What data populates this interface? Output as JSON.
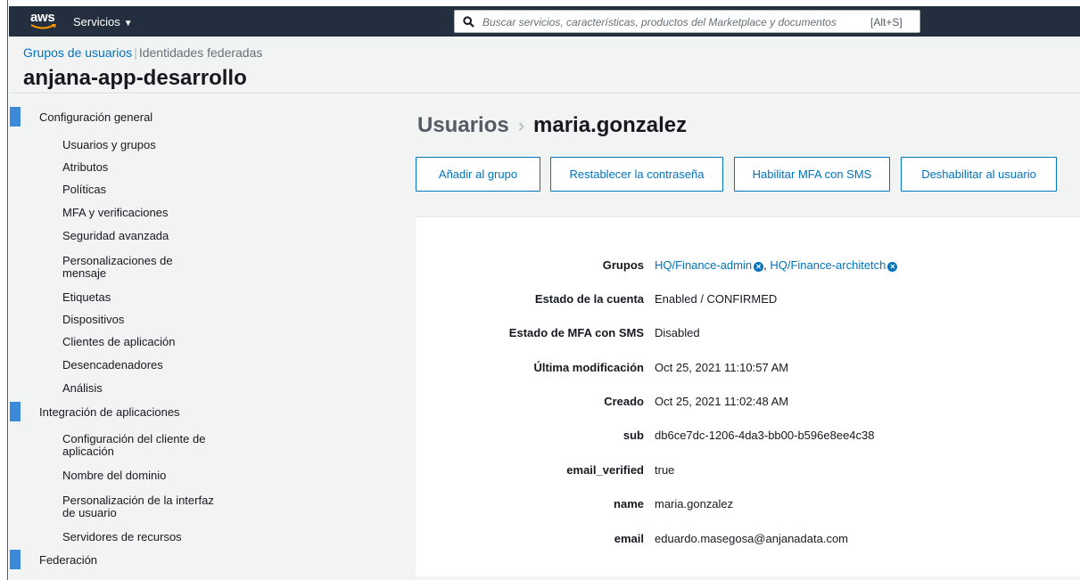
{
  "topnav": {
    "logo_text": "aws",
    "services_label": "Servicios",
    "search_placeholder": "Buscar servicios, características, productos del Marketplace y documentos",
    "search_shortcut": "[Alt+S]"
  },
  "header": {
    "tab_active": "Grupos de usuarios",
    "tab_inactive": "Identidades federadas",
    "pool_name": "anjana-app-desarrollo"
  },
  "sidebar": {
    "sections": [
      {
        "label": "Configuración general",
        "items": [
          "Usuarios y grupos",
          "Atributos",
          "Políticas",
          "MFA y verificaciones",
          "Seguridad avanzada",
          "Personalizaciones de mensaje",
          "Etiquetas",
          "Dispositivos",
          "Clientes de aplicación",
          "Desencadenadores",
          "Análisis"
        ]
      },
      {
        "label": "Integración de aplicaciones",
        "items": [
          "Configuración del cliente de aplicación",
          "Nombre del dominio",
          "Personalización de la interfaz de usuario",
          "Servidores de recursos"
        ]
      },
      {
        "label": "Federación",
        "items": []
      }
    ]
  },
  "main": {
    "breadcrumb": "Usuarios",
    "username": "maria.gonzalez",
    "buttons": {
      "add_group": "Añadir al grupo",
      "reset_password": "Restablecer la contraseña",
      "enable_mfa": "Habilitar MFA con SMS",
      "disable_user": "Deshabilitar al usuario"
    },
    "details": {
      "groups_label": "Grupos",
      "groups": [
        "HQ/Finance-admin",
        "HQ/Finance-architetch"
      ],
      "account_status_label": "Estado de la cuenta",
      "account_status": "Enabled / CONFIRMED",
      "mfa_status_label": "Estado de MFA con SMS",
      "mfa_status": "Disabled",
      "modified_label": "Última modificación",
      "modified": "Oct 25, 2021 11:10:57 AM",
      "created_label": "Creado",
      "created": "Oct 25, 2021 11:02:48 AM",
      "sub_label": "sub",
      "sub": "db6ce7dc-1206-4da3-bb00-b596e8ee4c38",
      "email_verified_label": "email_verified",
      "email_verified": "true",
      "name_label": "name",
      "name": "maria.gonzalez",
      "email_label": "email",
      "email": "eduardo.masegosa@anjanadata.com"
    }
  },
  "colors": {
    "nav_bg": "#232f3e",
    "accent": "#0073bb",
    "section_marker": "#3b8ad8",
    "panel_bg": "#f2f3f3"
  },
  "icons": {
    "search": "search-icon",
    "remove": "remove-circle-icon",
    "caret": "caret-down-icon",
    "breadcrumb_sep": "chevron-right-icon"
  }
}
